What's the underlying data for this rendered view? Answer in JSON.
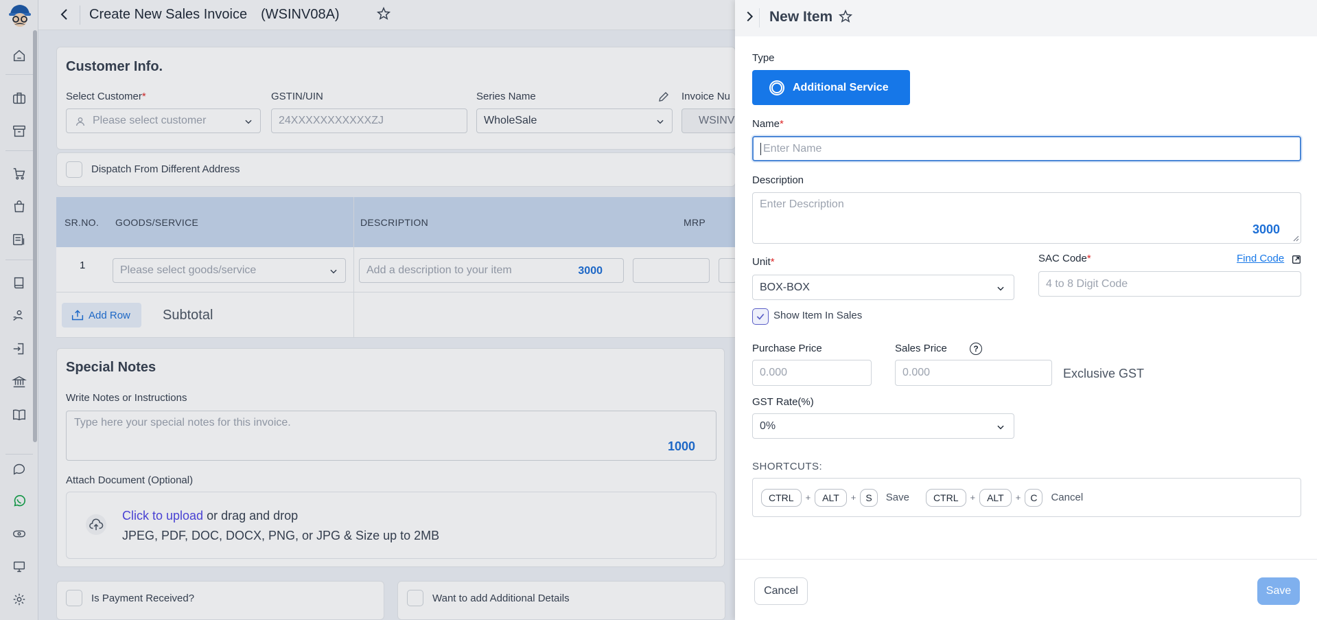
{
  "page": {
    "title": "Create New Sales Invoice",
    "invoice_code": "(WSINV08A)"
  },
  "customer": {
    "heading": "Customer Info.",
    "select_label": "Select Customer",
    "select_placeholder": "Please select customer",
    "gstin_label": "GSTIN/UIN",
    "gstin_placeholder": "24XXXXXXXXXXXZJ",
    "series_label": "Series Name",
    "series_value": "WholeSale",
    "invoice_no_label": "Invoice Nu",
    "invoice_no_value": "WSINV",
    "dispatch_label": "Dispatch From Different Address"
  },
  "table": {
    "headers": [
      "SR.NO.",
      "GOODS/SERVICE",
      "DESCRIPTION",
      "MRP"
    ],
    "row_no": "1",
    "goods_placeholder": "Please select goods/service",
    "desc_placeholder": "Add a description to your item",
    "desc_counter": "3000",
    "add_row": "Add Row",
    "subtotal": "Subtotal"
  },
  "notes": {
    "heading": "Special Notes",
    "label": "Write Notes or Instructions",
    "placeholder": "Type here your special notes for this invoice.",
    "counter": "1000",
    "attach_label": "Attach Document (Optional)",
    "upload_link": "Click to upload",
    "upload_rest": "or drag and drop",
    "upload_hint": "JPEG, PDF, DOC, DOCX, PNG, or JPG & Size up to 2MB"
  },
  "bottom": {
    "payment": "Is Payment Received?",
    "additional": "Want to add Additional Details"
  },
  "drawer": {
    "title": "New Item",
    "type_label": "Type",
    "type_value": "Additional Service",
    "name_label": "Name",
    "name_placeholder": "Enter Name",
    "desc_label": "Description",
    "desc_placeholder": "Enter Description",
    "desc_counter": "3000",
    "unit_label": "Unit",
    "unit_value": "BOX-BOX",
    "sac_label": "SAC Code",
    "find_code": "Find Code",
    "sac_placeholder": "4 to 8 Digit Code",
    "show_in_sales": "Show Item In Sales",
    "purchase_label": "Purchase Price",
    "purchase_placeholder": "0.000",
    "sales_label": "Sales Price",
    "sales_placeholder": "0.000",
    "exclusive_gst": "Exclusive GST",
    "gst_label": "GST Rate(%)",
    "gst_value": "0%",
    "shortcuts_label": "SHORTCUTS:",
    "shortcut_save_keys": [
      "CTRL",
      "ALT",
      "S"
    ],
    "shortcut_save_text": "Save",
    "shortcut_cancel_keys": [
      "CTRL",
      "ALT",
      "C"
    ],
    "shortcut_cancel_text": "Cancel",
    "cancel_button": "Cancel",
    "save_button": "Save"
  },
  "colors": {
    "primary": "#1677e8",
    "save_disabled": "#7fb0ee",
    "required": "#dc2626",
    "link": "#1677e8",
    "counter": "#1d6fd6",
    "table_header": "#c7d7ee"
  }
}
